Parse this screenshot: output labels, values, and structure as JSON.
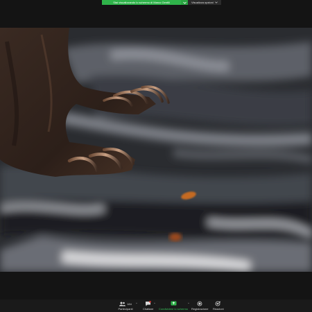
{
  "banner": {
    "sharing_text": "Stai visualizzando lo schermo di Marco Gentili",
    "view_options_label": "Visualizza opzioni",
    "accent_color": "#2fb34a"
  },
  "toolbar": {
    "participants_label": "Partecipanti",
    "participants_count": "184",
    "chat_label": "Chattare",
    "share_label": "Condividere lo schermo",
    "record_label": "Registrazione",
    "reactions_label": "Reazioni"
  },
  "icons": {
    "participants": "people-icon",
    "chat": "chat-bubble-icon",
    "share": "share-screen-icon",
    "record": "record-icon",
    "reactions": "heart-plus-icon"
  }
}
